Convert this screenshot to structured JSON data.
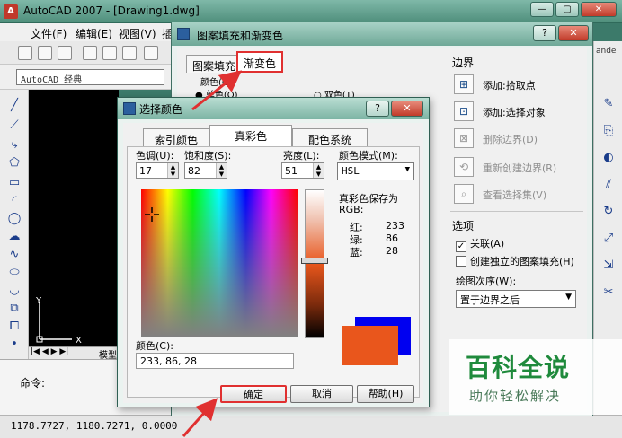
{
  "autocad": {
    "title": "AutoCAD 2007 - [Drawing1.dwg]",
    "menu": [
      "文件(F)",
      "编辑(E)",
      "视图(V)",
      "插"
    ],
    "workspace": "AutoCAD 经典",
    "ucs_y": "Y",
    "ucs_x": "X",
    "model_tab": "模型",
    "command_prompt": "命令:",
    "coordinates": "1178.7727, 1180.7271, 0.0000",
    "right_edge_text": "ande"
  },
  "hatch_dialog": {
    "title": "图案填充和渐变色",
    "help_button": "?",
    "close_button": "✕",
    "tabs": [
      "图案填充",
      "渐变色"
    ],
    "color_label": "颜色(C)",
    "single_color": "单色(O)",
    "two_color": "双色(T)",
    "boundaries_label": "边界",
    "actions": [
      {
        "label": "添加:拾取点",
        "icon": "pick-points-icon",
        "enabled": true
      },
      {
        "label": "添加:选择对象",
        "icon": "select-objects-icon",
        "enabled": true
      },
      {
        "label": "删除边界(D)",
        "icon": "remove-boundary-icon",
        "enabled": false
      },
      {
        "label": "重新创建边界(R)",
        "icon": "recreate-boundary-icon",
        "enabled": false
      },
      {
        "label": "查看选择集(V)",
        "icon": "view-selections-icon",
        "enabled": false
      }
    ],
    "options_label": "选项",
    "associative": "关联(A)",
    "create_separate": "创建独立的图案填充(H)",
    "draw_order_label": "绘图次序(W):",
    "draw_order_value": "置于边界之后"
  },
  "color_dialog": {
    "title": "选择颜色",
    "help_button": "?",
    "close_button": "✕",
    "tabs": [
      "索引颜色",
      "真彩色",
      "配色系统"
    ],
    "hue_label": "色调(U):",
    "hue_value": "17",
    "saturation_label": "饱和度(S):",
    "saturation_value": "82",
    "luminance_label": "亮度(L):",
    "luminance_value": "51",
    "color_model_label": "颜色模式(M):",
    "color_model_value": "HSL",
    "truecolor_saved_as": "真彩色保存为",
    "rgb_label": "RGB:",
    "red_label": "红:",
    "red_value": "233",
    "green_label": "绿:",
    "green_value": "86",
    "blue_label": "蓝:",
    "blue_value": "28",
    "color_field_label": "颜色(C):",
    "color_field_value": "233, 86, 28",
    "ok_button": "确定",
    "cancel_button": "取消",
    "help_text_button": "帮助(H)",
    "current_color": "#e9561c",
    "new_color": "#0000f0"
  },
  "watermark": {
    "main": "百科全说",
    "sub": "助你轻松解决"
  },
  "colors": {
    "highlight_red": "#e03030",
    "arrow_red": "#e03030",
    "watermark_green": "#1f8a3c"
  }
}
